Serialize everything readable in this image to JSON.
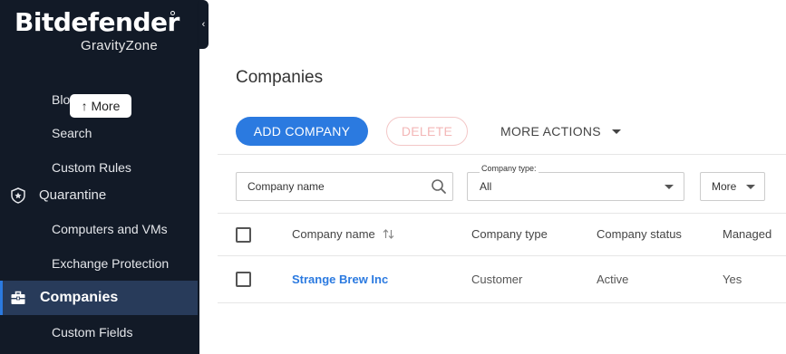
{
  "brand": {
    "name": "Bitdefender",
    "product": "GravityZone"
  },
  "sidebar": {
    "tooltip": "↑ More",
    "partial_item": "Blo",
    "items": [
      {
        "label": "Search"
      },
      {
        "label": "Custom Rules"
      },
      {
        "label": "Quarantine",
        "icon": "shield-star-icon"
      },
      {
        "label": "Computers and VMs"
      },
      {
        "label": "Exchange Protection"
      },
      {
        "label": "Companies",
        "icon": "briefcase-icon",
        "active": true
      },
      {
        "label": "Custom Fields"
      }
    ]
  },
  "main": {
    "title": "Companies",
    "actions": {
      "add": "ADD COMPANY",
      "delete": "DELETE",
      "more": "MORE ACTIONS"
    },
    "filters": {
      "search_placeholder": "Company name",
      "type_label": "Company type:",
      "type_value": "All",
      "more_label": "More"
    },
    "table": {
      "headers": [
        "Company name",
        "Company type",
        "Company status",
        "Managed"
      ],
      "rows": [
        {
          "name": "Strange Brew Inc",
          "type": "Customer",
          "status": "Active",
          "managed": "Yes"
        }
      ]
    }
  },
  "colors": {
    "accent": "#2b7ae0",
    "sidebar_bg": "#121a27",
    "sidebar_active": "#283b5a",
    "delete_disabled": "#f3b7b7"
  }
}
